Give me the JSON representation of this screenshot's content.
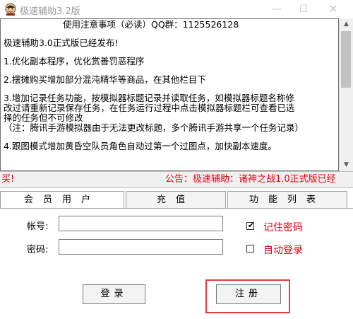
{
  "window": {
    "title": "极速辅助3.2版",
    "minimize_glyph": "—",
    "maximize_glyph": "☐",
    "close_glyph": "✕",
    "icon": "monk-avatar-icon"
  },
  "notes": {
    "title": "使用注意事项（必读）QQ群：1125526128",
    "lines": [
      "极速辅助3.0正式版已经发布!",
      "1.优化副本程序，优化赏善罚恶程序",
      "2.摆摊购买增加部分混沌精华等商品，在其他栏目下",
      "3.增加记录任务功能，按模拟器标题记录并读取任务，如模拟器标题名称修",
      "改过请重新记录保存任务，在任务运行过程中点击模拟器标题栏可查看已选",
      "择的任务但不可修改",
      "（注：腾讯手游模拟器由于无法更改标题，多个腾讯手游共享一个任务记录）",
      "4.跟图模式增加黄昏空队员角色自动过第一个过图点，加快副本速度。"
    ]
  },
  "announcement": {
    "left_text": "买!",
    "right_text": "公告：极速辅助：诸神之战1.0正式版已经"
  },
  "tabs": [
    "会员用户",
    "充值",
    "功能列表"
  ],
  "login": {
    "account_label": "帐号:",
    "account_value": "",
    "password_label": "密码:",
    "password_value": "",
    "remember_label": "记住密码",
    "remember_checked": "✔",
    "autologin_label": "自动登录",
    "login_button": "登录",
    "register_button": "注册"
  },
  "colors": {
    "accent_red": "#e60012",
    "highlight_box": "#e04040"
  }
}
